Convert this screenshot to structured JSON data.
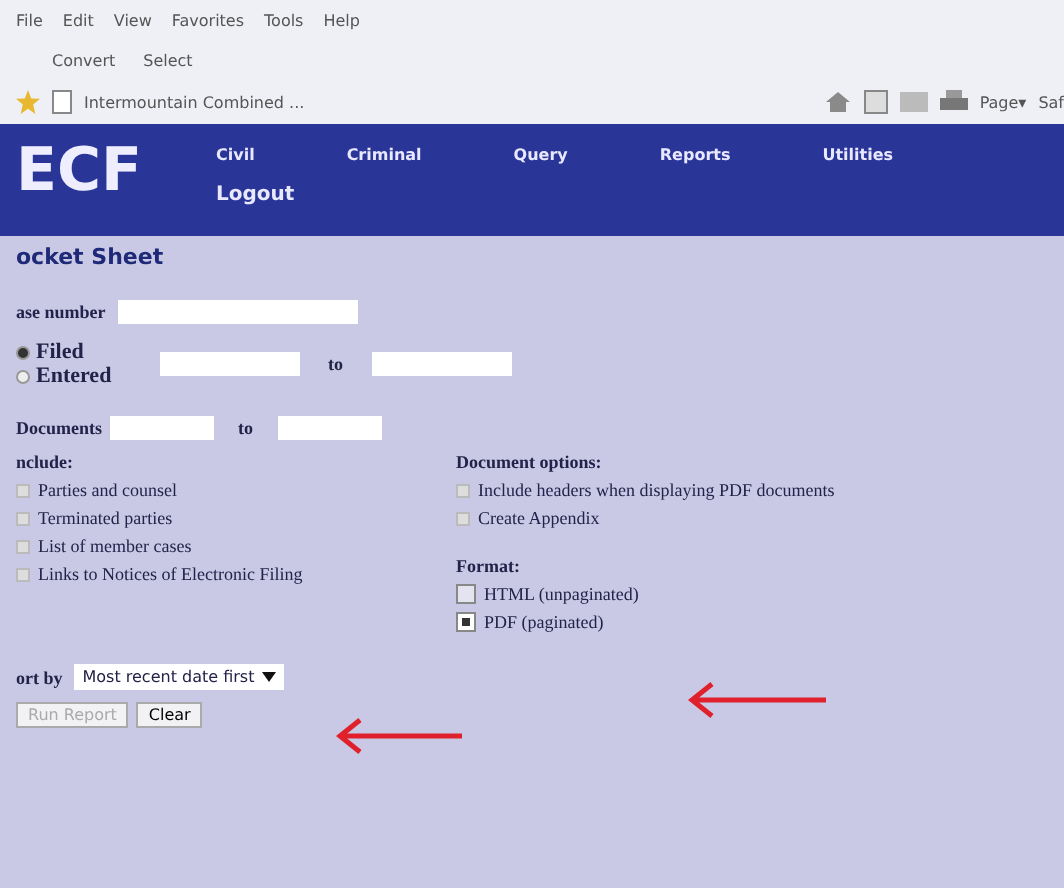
{
  "browser": {
    "menu": [
      "File",
      "Edit",
      "View",
      "Favorites",
      "Tools",
      "Help"
    ],
    "links": [
      "Convert",
      "Select"
    ],
    "tab": "Intermountain Combined ...",
    "page_menu": "Page▾",
    "safety_menu": "Saf"
  },
  "nav": {
    "logo": "ECF",
    "items": [
      "Civil",
      "Criminal",
      "Query",
      "Reports",
      "Utilities"
    ],
    "logout": "Logout"
  },
  "title": "ocket Sheet",
  "case_number": {
    "label": "ase number"
  },
  "date_range": {
    "options": [
      {
        "label": "Filed",
        "selected": true
      },
      {
        "label": "Entered",
        "selected": false
      }
    ],
    "to": "to"
  },
  "documents": {
    "label": "Documents",
    "to": "to"
  },
  "include": {
    "label": "nclude:",
    "items": [
      {
        "label": "Parties and counsel",
        "checked": false
      },
      {
        "label": "Terminated parties",
        "checked": false
      },
      {
        "label": "List of member cases",
        "checked": false
      },
      {
        "label": "Links to Notices of Electronic Filing",
        "checked": false
      }
    ]
  },
  "document_options": {
    "label": "Document options:",
    "items": [
      {
        "label": "Include headers when displaying PDF documents",
        "checked": false
      },
      {
        "label": "Create Appendix",
        "checked": false
      }
    ]
  },
  "format": {
    "label": "Format:",
    "options": [
      {
        "label": "HTML (unpaginated)",
        "selected": false
      },
      {
        "label": "PDF (paginated)",
        "selected": true
      }
    ]
  },
  "sort": {
    "label": "ort by",
    "value": "Most recent date first"
  },
  "buttons": [
    {
      "label": "Run Report",
      "disabled": true
    },
    {
      "label": "Clear",
      "disabled": false
    }
  ]
}
